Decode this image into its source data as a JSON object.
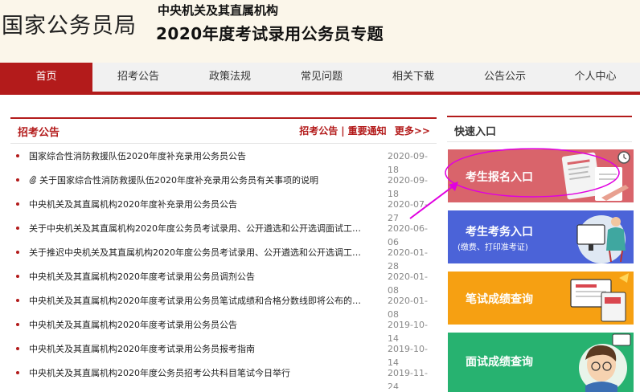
{
  "header": {
    "site_title": "国家公务员局",
    "subtitle_line1": "中央机关及其直属机构",
    "subtitle_line2": "2020年度考试录用公务员专题"
  },
  "nav": {
    "items": [
      {
        "label": "首页",
        "active": true
      },
      {
        "label": "招考公告"
      },
      {
        "label": "政策法规"
      },
      {
        "label": "常见问题"
      },
      {
        "label": "相关下载"
      },
      {
        "label": "公告公示"
      },
      {
        "label": "个人中心"
      }
    ]
  },
  "announcements": {
    "title": "招考公告",
    "links": {
      "a": "招考公告",
      "b": "重要通知",
      "more": "更多>>"
    },
    "items": [
      {
        "title": "国家综合性消防救援队伍2020年度补充录用公务员公告",
        "date": "2020-09-18"
      },
      {
        "title": "关于国家综合性消防救援队伍2020年度补充录用公务员有关事项的说明",
        "date": "2020-09-18",
        "attachment": true
      },
      {
        "title": "中央机关及其直属机构2020年度补充录用公务员公告",
        "date": "2020-07-27"
      },
      {
        "title": "关于中央机关及其直属机构2020年度公务员考试录用、公开遴选和公开选调面试工作的公告",
        "date": "2020-06-06"
      },
      {
        "title": "关于推迟中央机关及其直属机构2020年度公务员考试录用、公开遴选和公开选调工作的公告",
        "date": "2020-01-28"
      },
      {
        "title": "中央机关及其直属机构2020年度考试录用公务员调剂公告",
        "date": "2020-01-08"
      },
      {
        "title": "中央机关及其直属机构2020年度考试录用公务员笔试成绩和合格分数线即将公布的公告",
        "date": "2020-01-08"
      },
      {
        "title": "中央机关及其直属机构2020年度考试录用公务员公告",
        "date": "2019-10-14"
      },
      {
        "title": "中央机关及其直属机构2020年度考试录用公务员报考指南",
        "date": "2019-10-14"
      },
      {
        "title": "中央机关及其直属机构2020年度公务员招考公共科目笔试今日举行",
        "date": "2019-11-24"
      }
    ]
  },
  "quick": {
    "title": "快速入口",
    "cards": [
      {
        "label": "考生报名入口",
        "color": "#d9646b"
      },
      {
        "label": "考生考务入口",
        "sub": "(缴费、打印准考证)",
        "color": "#4b63d8"
      },
      {
        "label": "笔试成绩查询",
        "color": "#f6a012"
      },
      {
        "label": "面试成绩查询",
        "color": "#27b270"
      }
    ]
  },
  "colors": {
    "brand_red": "#b31b1b",
    "highlight": "#e000e0",
    "header_bg": "#fbf6ea"
  }
}
